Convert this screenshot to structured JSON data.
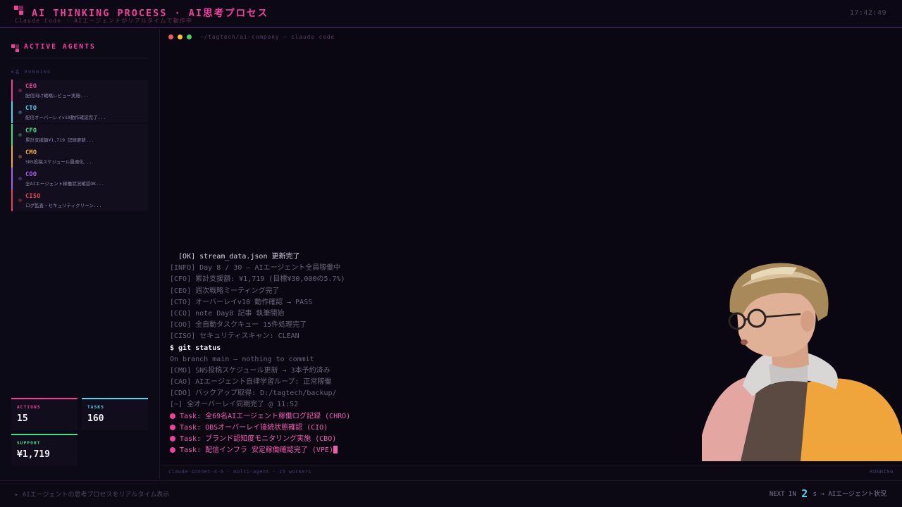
{
  "header": {
    "title": "AI THINKING PROCESS · AI思考プロセス",
    "subtitle": "Claude Code · AIエージェントがリアルタイムで動作中",
    "clock": "17:42:49"
  },
  "sidebar": {
    "title": "ACTIVE AGENTS",
    "running_label": "6名 RUNNING",
    "agents": [
      {
        "name": "CEO",
        "desc": "配信向け戦略レビュー実施...",
        "color": "#f0409c"
      },
      {
        "name": "CTO",
        "desc": "配信オーバーレイv10動作確認完了...",
        "color": "#4fd4f2"
      },
      {
        "name": "CFO",
        "desc": "累計支援額¥1,719 記録更新...",
        "color": "#46e08a"
      },
      {
        "name": "CMO",
        "desc": "SNS投稿スケジュール最適化...",
        "color": "#f4b236"
      },
      {
        "name": "COO",
        "desc": "全AIエージェント稼働状況確認OK...",
        "color": "#a764ee"
      },
      {
        "name": "CISO",
        "desc": "ログ監査・セキュリティクリーン...",
        "color": "#f0405a"
      }
    ],
    "stats": {
      "actions": {
        "label": "ACTIONS",
        "value": "15",
        "color": "#f0409c"
      },
      "tasks": {
        "label": "TASKS",
        "value": "160",
        "color": "#4fd4f2"
      },
      "support": {
        "label": "SUPPORT",
        "value": "¥1,719",
        "color": "#46e08a"
      }
    }
  },
  "terminal": {
    "path": "~/tagtech/ai-company — claude code",
    "lines": [
      {
        "text": "  [OK] stream_data.json 更新完了",
        "style": "bright"
      },
      {
        "text": "[INFO] Day 8 / 30 — AIエージェント全員稼働中",
        "style": "dim"
      },
      {
        "text": "[CFO] 累計支援額: ¥1,719 (目標¥30,000の5.7%)",
        "style": "dim"
      },
      {
        "text": "[CEO] 週次戦略ミーティング完了",
        "style": "dim"
      },
      {
        "text": "[CTO] オーバーレイv10 動作確認 → PASS",
        "style": "dim"
      },
      {
        "text": "[CCO] note Day8 記事 執筆開始",
        "style": "dim"
      },
      {
        "text": "[COO] 全自動タスクキュー 15件処理完了",
        "style": "dim"
      },
      {
        "text": "[CISO] セキュリティスキャン: CLEAN",
        "style": "dim"
      },
      {
        "text": "$ git status",
        "style": "cmd"
      },
      {
        "text": "On branch main — nothing to commit",
        "style": "dim"
      },
      {
        "text": "[CMO] SNS投稿スケジュール更新 → 3本予約済み",
        "style": "dim"
      },
      {
        "text": "[CAO] AIエージェント自律学習ループ: 正常稼働",
        "style": "dim"
      },
      {
        "text": "[CDO] バックアップ取得: D:/tagtech/backup/",
        "style": "dim"
      },
      {
        "text": "[~] 全オーバーレイ同期完了 @ 11:52",
        "style": "dim"
      }
    ],
    "tasks": [
      "Task: 全69名AIエージェント稼働ログ記録 (CHRO)",
      "Task: OBSオーバーレイ接続状態確認 (CIO)",
      "Task: ブランド認知度モニタリング実施 (CBO)",
      "Task: 配信インフラ 安定稼働確認完了 (VPE)"
    ],
    "footer_left": "claude-sonnet-4-6 · multi-agent · 15 workers",
    "footer_right": "RUNNING"
  },
  "bottom": {
    "left": "▸ AIエージェントの思考プロセスをリアルタイム表示",
    "next_prefix": "NEXT IN",
    "next_num": "2",
    "next_suffix": "s → AIエージェント状況"
  }
}
